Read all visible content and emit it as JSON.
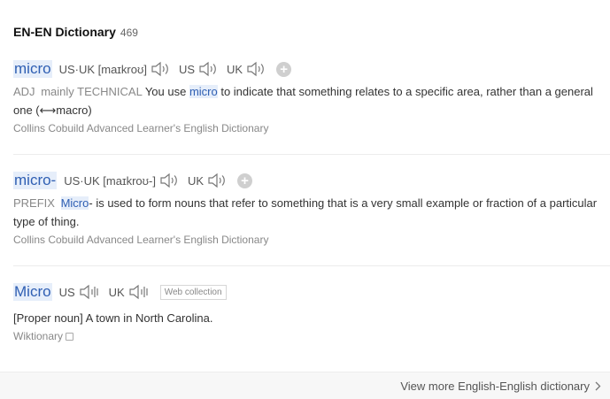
{
  "header": {
    "title": "EN-EN Dictionary",
    "count": "469"
  },
  "entries": [
    {
      "headword": "micro",
      "pron_us_uk": "US·UK [maɪkroʊ]",
      "region_us": "US",
      "region_uk": "UK",
      "pos": "ADJ",
      "grammar": "mainly TECHNICAL",
      "def_pre": "You use ",
      "def_hl": "micro",
      "def_post": " to indicate that something relates to a specific area, rather than a general one (⟷macro)",
      "source": "Collins Cobuild Advanced Learner's English Dictionary"
    },
    {
      "headword": "micro-",
      "pron_us_uk": "US·UK [maɪkroʊ-]",
      "region_uk": "UK",
      "pos": "PREFIX",
      "def_hl": "Micro",
      "def_post": "- is used to form nouns that refer to something that is a very small example or fraction of a particular type of thing.",
      "source": "Collins Cobuild Advanced Learner's English Dictionary"
    },
    {
      "headword": "Micro",
      "region_us": "US",
      "region_uk": "UK",
      "badge": "Web collection",
      "def": "[Proper noun] A town in North Carolina.",
      "source": "Wiktionary"
    }
  ],
  "footer": {
    "link": "View more English-English dictionary"
  },
  "icons": {
    "speaker": "speaker-icon",
    "plus": "plus-icon",
    "chevron": "chevron-right-icon",
    "external": "external-link-icon",
    "waveform": "waveform-icon"
  },
  "colors": {
    "headword": "#2f5fb3",
    "highlight_bg": "#e6eefa",
    "muted": "#888888"
  }
}
